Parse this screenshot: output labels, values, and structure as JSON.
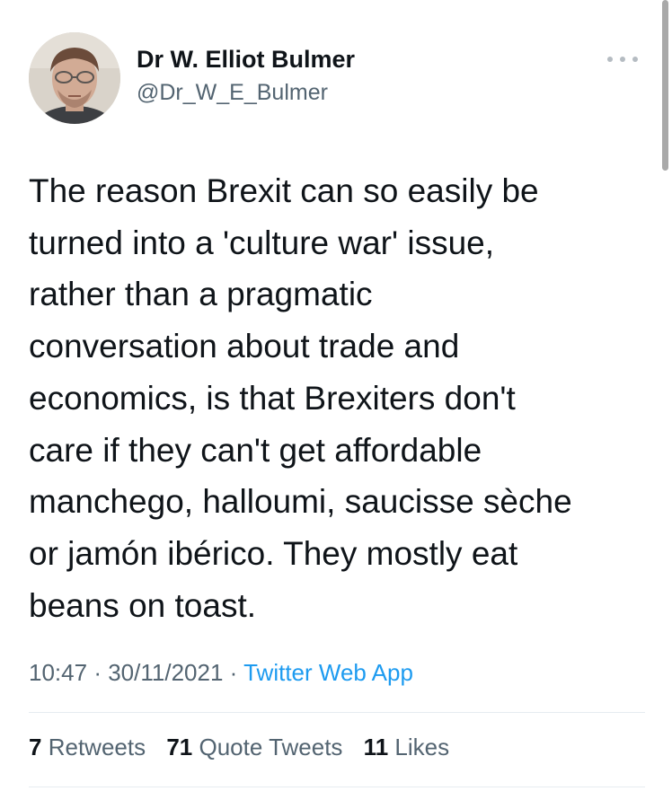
{
  "tweet": {
    "author": {
      "display_name": "Dr W. Elliot Bulmer",
      "handle": "@Dr_W_E_Bulmer"
    },
    "text": "The reason Brexit can so easily be\nturned into a 'culture war' issue,\nrather than a pragmatic\nconversation about trade and\neconomics, is that Brexiters don't\ncare if they can't get affordable\nmanchego, halloumi, saucisse sèche\nor jamón ibérico. They mostly eat\nbeans on toast.",
    "time": "10:47",
    "date": "30/11/2021",
    "separator": "·",
    "source": "Twitter Web App",
    "stats": {
      "retweets_count": "7",
      "retweets_label": "Retweets",
      "quote_tweets_count": "71",
      "quote_tweets_label": "Quote Tweets",
      "likes_count": "11",
      "likes_label": "Likes"
    }
  },
  "icons": {
    "more": "more-horizontal-icon",
    "avatar": "profile-photo"
  },
  "colors": {
    "text_primary": "#0f1419",
    "text_secondary": "#536471",
    "link": "#1d9bf0",
    "divider": "#e6ecf0"
  }
}
